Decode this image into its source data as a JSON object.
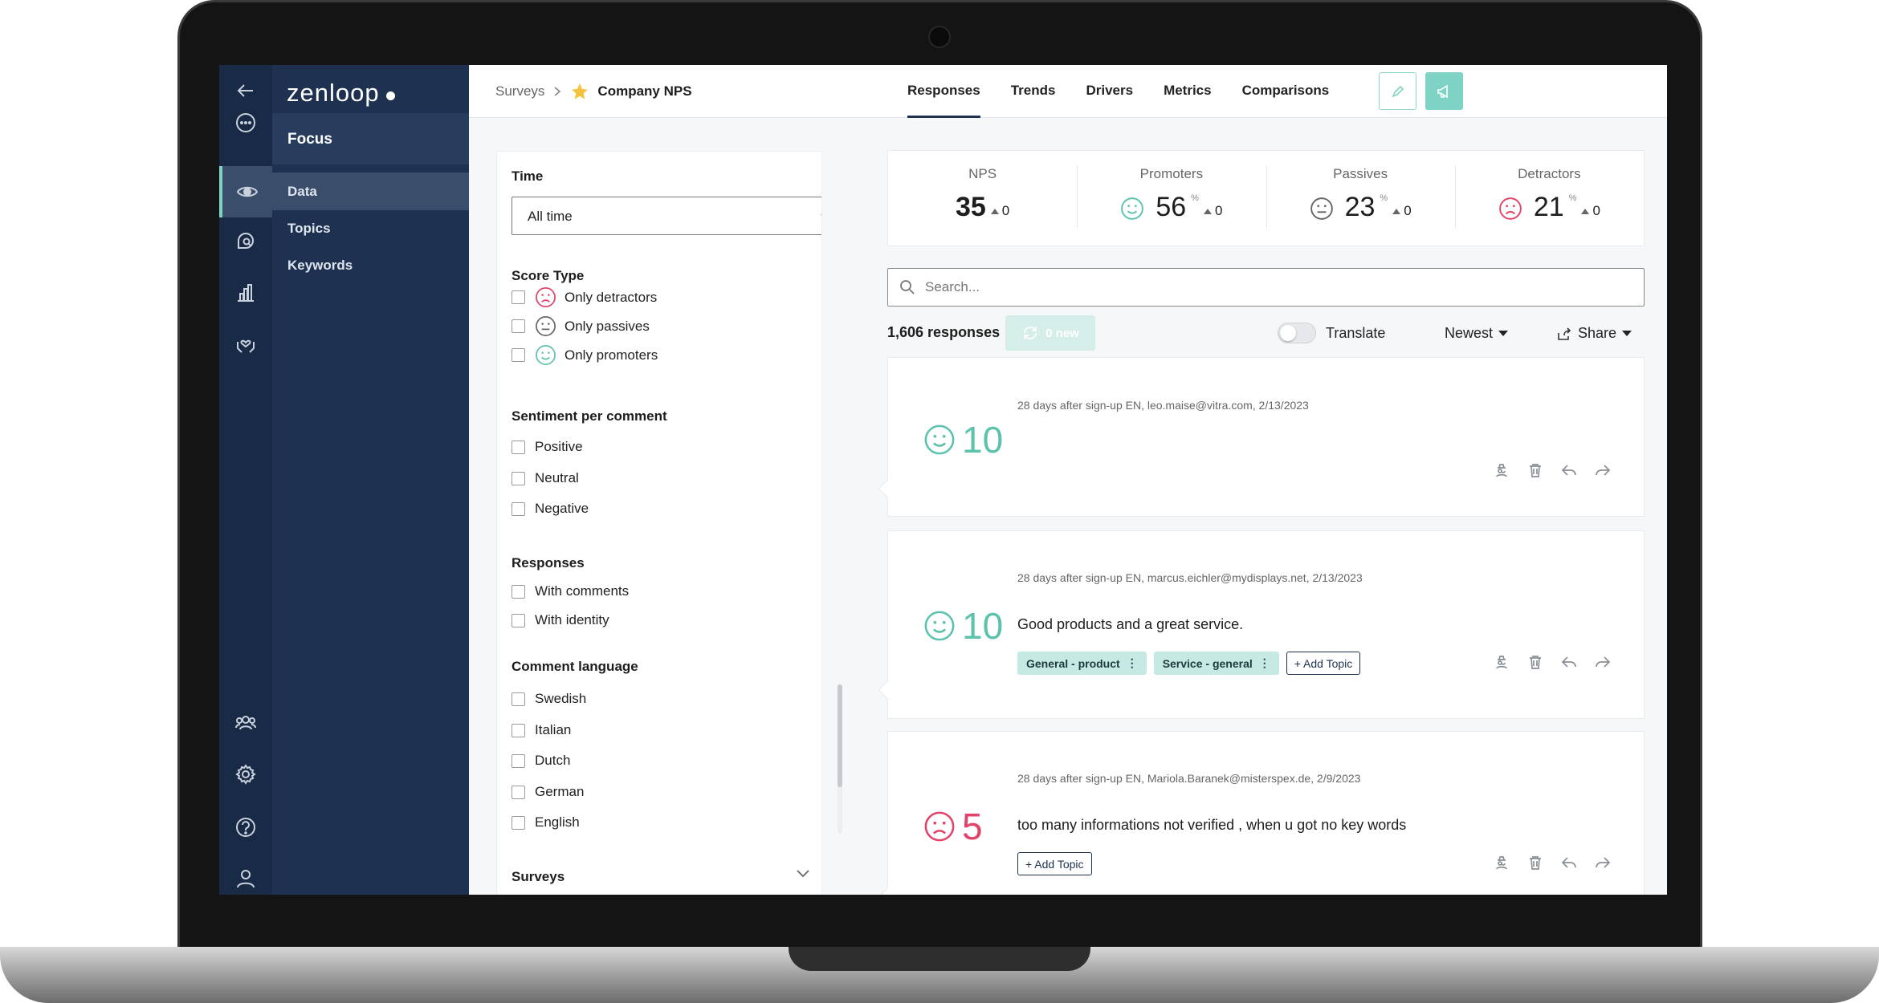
{
  "brand": {
    "name": "zenloop"
  },
  "nav": {
    "panel_title": "Focus",
    "items": [
      {
        "label": "Data"
      },
      {
        "label": "Topics"
      },
      {
        "label": "Keywords"
      }
    ]
  },
  "header": {
    "breadcrumb_root": "Surveys",
    "survey_name": "Company NPS",
    "tabs": [
      {
        "label": "Responses"
      },
      {
        "label": "Trends"
      },
      {
        "label": "Drivers"
      },
      {
        "label": "Metrics"
      },
      {
        "label": "Comparisons"
      }
    ]
  },
  "filters": {
    "time": {
      "title": "Time",
      "value": "All time"
    },
    "score_type": {
      "title": "Score Type",
      "options": [
        "Only detractors",
        "Only passives",
        "Only promoters"
      ]
    },
    "sentiment": {
      "title": "Sentiment per comment",
      "options": [
        "Positive",
        "Neutral",
        "Negative"
      ]
    },
    "responses": {
      "title": "Responses",
      "options": [
        "With comments",
        "With identity"
      ]
    },
    "language": {
      "title": "Comment language",
      "options": [
        "Swedish",
        "Italian",
        "Dutch",
        "German",
        "English"
      ]
    },
    "surveys": {
      "title": "Surveys"
    }
  },
  "stats": {
    "nps": {
      "label": "NPS",
      "value": "35",
      "delta": "0"
    },
    "promoters": {
      "label": "Promoters",
      "value": "56",
      "unit": "%",
      "delta": "0"
    },
    "passives": {
      "label": "Passives",
      "value": "23",
      "unit": "%",
      "delta": "0"
    },
    "detractors": {
      "label": "Detractors",
      "value": "21",
      "unit": "%",
      "delta": "0"
    }
  },
  "search": {
    "placeholder": "Search..."
  },
  "toolbar": {
    "count": "1,606 responses",
    "new_label": "0 new",
    "translate": "Translate",
    "sort": "Newest",
    "share": "Share"
  },
  "responses": [
    {
      "score": "10",
      "meta": "28 days after sign-up EN, leo.maise@vitra.com, 2/13/2023",
      "comment": "",
      "topics": []
    },
    {
      "score": "10",
      "meta": "28 days after sign-up EN, marcus.eichler@mydisplays.net, 2/13/2023",
      "comment": "Good products and a great service.",
      "topics": [
        "General - product",
        "Service - general"
      ]
    },
    {
      "score": "5",
      "meta": "28 days after sign-up EN, Mariola.Baranek@misterspex.de, 2/9/2023",
      "comment": "too many informations not verified , when u got no key words",
      "topics": []
    }
  ],
  "add_topic_label": "+ Add Topic",
  "colors": {
    "promoter": "#5cc2ae",
    "detractor": "#e2436a",
    "passive": "#666666",
    "navy": "#1e3150"
  }
}
